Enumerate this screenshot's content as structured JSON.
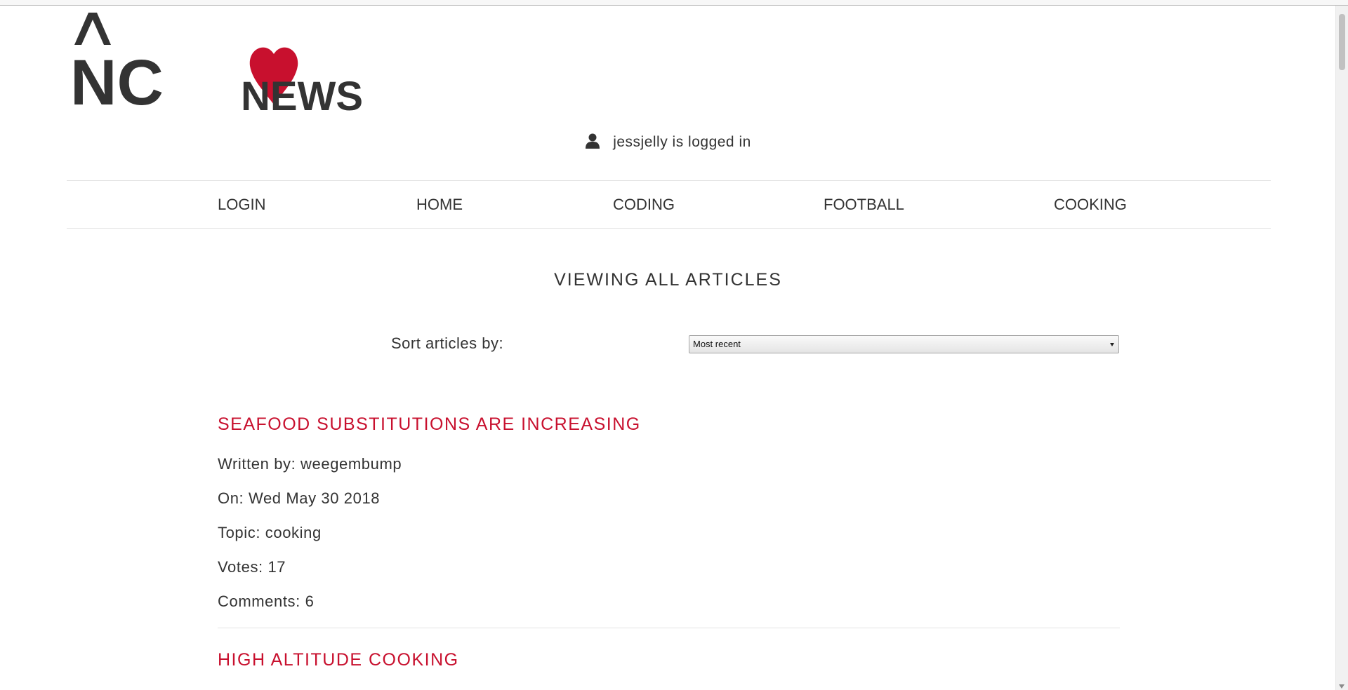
{
  "logo": {
    "text_nc": "NC",
    "text_news": "NEWS",
    "heart_color": "#c8102e",
    "text_color": "#333333"
  },
  "user_status": {
    "icon": "user-icon",
    "text": "jessjelly is logged in"
  },
  "nav": {
    "items": [
      {
        "label": "LOGIN"
      },
      {
        "label": "HOME"
      },
      {
        "label": "CODING"
      },
      {
        "label": "FOOTBALL"
      },
      {
        "label": "COOKING"
      }
    ]
  },
  "main": {
    "heading": "VIEWING ALL ARTICLES",
    "sort": {
      "label": "Sort articles by:",
      "selected": "Most recent"
    }
  },
  "articles": [
    {
      "title": "SEAFOOD SUBSTITUTIONS ARE INCREASING",
      "author_line": "Written by: weegembump",
      "date_line": "On: Wed May 30 2018",
      "topic_line": "Topic: cooking",
      "votes_line": "Votes: 17",
      "comments_line": "Comments: 6"
    },
    {
      "title": "HIGH ALTITUDE COOKING"
    }
  ],
  "colors": {
    "accent": "#c8102e",
    "text": "#333333",
    "divider": "#e3e3e3"
  }
}
